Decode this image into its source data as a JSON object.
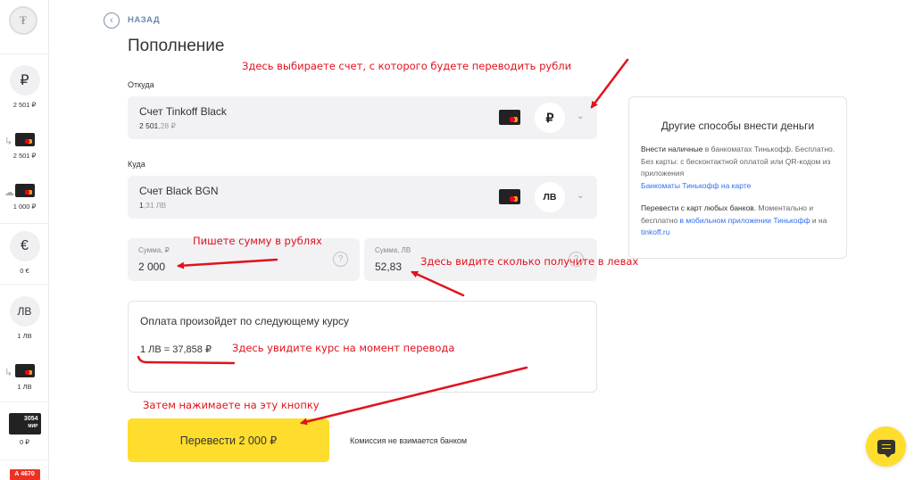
{
  "sidebar": {
    "logo_glyph": "₮",
    "items": [
      {
        "icon": "ruble-icon",
        "glyph": "₽",
        "value": "2 501 ₽"
      },
      {
        "icon": "card-icon",
        "value": "2 501 ₽"
      },
      {
        "icon": "card-icon",
        "value": "1 000 ₽"
      },
      {
        "icon": "euro-icon",
        "glyph": "€",
        "value": "0 €"
      },
      {
        "icon": "lev-icon",
        "glyph": "ЛВ",
        "value": "1 ЛВ"
      },
      {
        "icon": "card-icon",
        "value": "1 ЛВ"
      },
      {
        "icon": "mir-card-icon",
        "card_text": "3054",
        "card_brand": "МИР",
        "value": "0 ₽"
      },
      {
        "icon": "alfa-card-icon",
        "card_text": "А  4670"
      }
    ]
  },
  "header": {
    "back_label": "НАЗАД",
    "title": "Пополнение"
  },
  "from": {
    "label": "Откуда",
    "account_name": "Счет Tinkoff Black",
    "balance_main": "2 501",
    "balance_cents": ",28 ₽",
    "currency_glyph": "₽"
  },
  "to": {
    "label": "Куда",
    "account_name": "Счет Black BGN",
    "balance_main": "1",
    "balance_cents": ",31 ЛВ",
    "currency_glyph": "ЛВ"
  },
  "amount_rub": {
    "label": "Сумма, ₽",
    "value": "2 000"
  },
  "amount_lv": {
    "label": "Сумма, ЛВ",
    "value": "52,83"
  },
  "rate": {
    "text": "Оплата произойдет по следующему курсу",
    "value": "1 ЛВ = 37,858 ₽"
  },
  "transfer_button": "Перевести 2 000 ₽",
  "commission": "Комиссия не взимается банком",
  "other_methods": {
    "title": "Другие способы внести деньги",
    "p1_dark": "Внести наличные",
    "p1_rest": " в банкоматах Тинькофф. Бесплатно. Без карты: с бесконтактной оплатой или QR-кодом из приложения",
    "p1_link": "Банкоматы Тинькофф на карте",
    "p2_dark": "Перевести с карт любых банков.",
    "p2_rest": " Моментально и бесплатно ",
    "p2_link1": "в мобильном приложении Тинькофф",
    "p2_and": " и на ",
    "p2_link2": "tinkoff.ru"
  },
  "annotations": {
    "a1": "Здесь выбираете счет, с которого будете переводить рубли",
    "a2": "Пишете сумму в рублях",
    "a3": "Здесь видите сколько получите в левах",
    "a4": "Здесь увидите курс на момент перевода",
    "a5": "Затем нажимаете на эту кнопку"
  },
  "colors": {
    "accent": "#ffdd2d",
    "link": "#336fee",
    "annotation": "#e0131c",
    "field_bg": "#f2f2f5"
  }
}
